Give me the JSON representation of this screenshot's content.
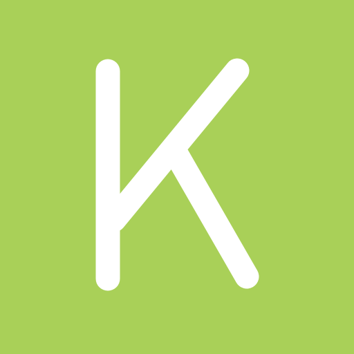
{
  "tile": {
    "letter": "K",
    "background_color": "#a9d058",
    "letter_color": "#ffffff"
  }
}
